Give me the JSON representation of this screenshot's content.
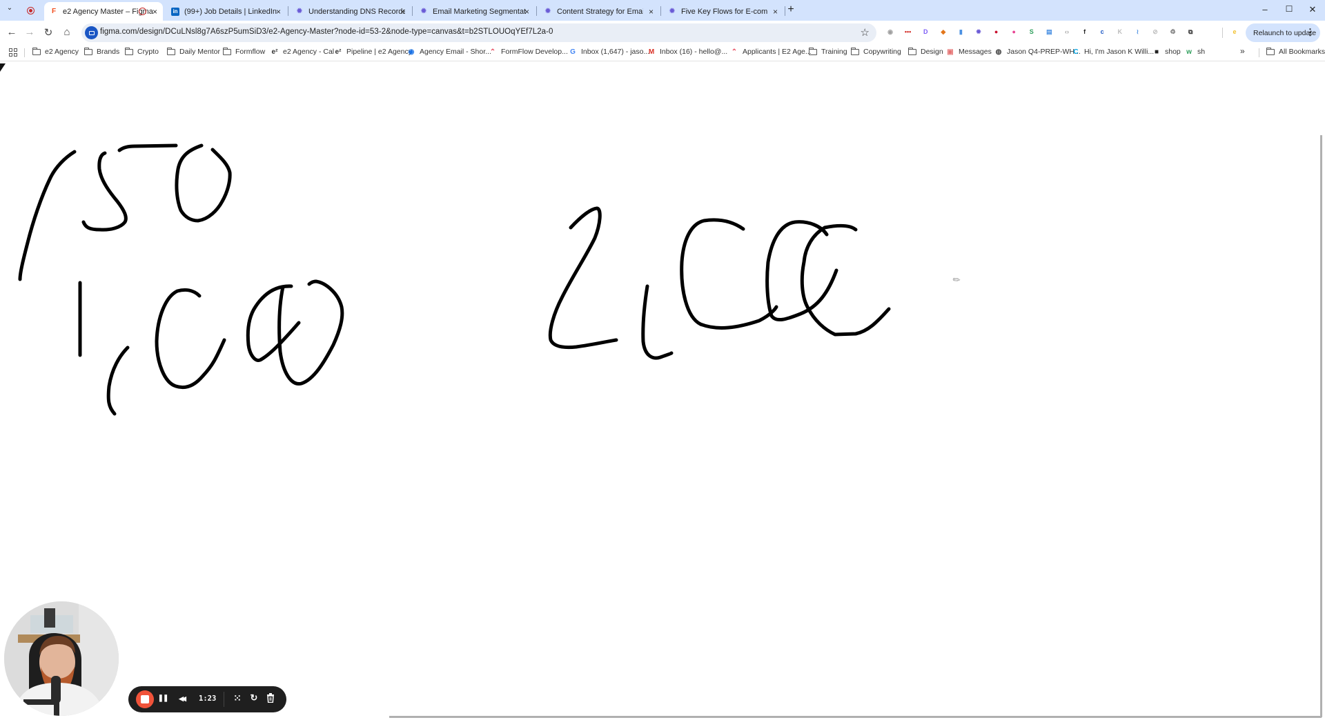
{
  "browser": {
    "tabs": [
      {
        "label": "e2 Agency Master – Figma",
        "favicon": "figma-icon",
        "active": true,
        "recording": true
      },
      {
        "label": "(99+) Job Details | LinkedIn",
        "favicon": "linkedin-icon",
        "active": false
      },
      {
        "label": "Understanding DNS Records 📊",
        "favicon": "gear-icon",
        "active": false
      },
      {
        "label": "Email Marketing Segmentation",
        "favicon": "gear-icon",
        "active": false
      },
      {
        "label": "Content Strategy for Email Mar",
        "favicon": "gear-icon",
        "active": false
      },
      {
        "label": "Five Key Flows for E-commerce",
        "favicon": "gear-icon",
        "active": false
      }
    ],
    "new_tab_label": "+",
    "close_label": "×",
    "window_controls": {
      "minimize": "–",
      "maximize": "☐",
      "close": "✕"
    },
    "nav": {
      "back": "←",
      "forward": "→",
      "reload": "↻",
      "home": "⌂"
    },
    "url": "figma.com/design/DCuLNsl8g7A6szP5umSiD3/e2-Agency-Master?node-id=53-2&node-type=canvas&t=b2STLOUOqYEf7L2a-0",
    "bookmark_star": "☆",
    "relaunch_label": "Relaunch to update",
    "menu_dots": "⋮",
    "extensions": [
      {
        "name": "camera-extension-icon",
        "glyph": "◉",
        "color": "#9e9e9e"
      },
      {
        "name": "lastpass-extension-icon",
        "glyph": "•••",
        "color": "#d32d27"
      },
      {
        "name": "d-extension-icon",
        "glyph": "D",
        "color": "#7c5cf5"
      },
      {
        "name": "metamask-extension-icon",
        "glyph": "◆",
        "color": "#e2761b"
      },
      {
        "name": "clipboard-extension-icon",
        "glyph": "▮",
        "color": "#4a90e2"
      },
      {
        "name": "gear-extension-icon",
        "glyph": "✹",
        "color": "#6b5bd6"
      },
      {
        "name": "recorder-extension-icon",
        "glyph": "●",
        "color": "#c8102e"
      },
      {
        "name": "color-picker-extension-icon",
        "glyph": "●",
        "color": "#e84393"
      },
      {
        "name": "whatsapp-extension-icon",
        "glyph": "S",
        "color": "#2e9e5b"
      },
      {
        "name": "window-extension-icon",
        "glyph": "▤",
        "color": "#4a90e2"
      },
      {
        "name": "code-extension-icon",
        "glyph": "‹›",
        "color": "#9e9e9e"
      },
      {
        "name": "font-extension-icon",
        "glyph": "f",
        "color": "#222222"
      },
      {
        "name": "blue-circle-extension-icon",
        "glyph": "c",
        "color": "#1a56c4"
      },
      {
        "name": "grey-k-extension-icon",
        "glyph": "K",
        "color": "#bdbdbd"
      },
      {
        "name": "wave-extension-icon",
        "glyph": "≀",
        "color": "#4a90e2"
      },
      {
        "name": "compass-extension-icon",
        "glyph": "⊘",
        "color": "#bdbdbd"
      },
      {
        "name": "recycle-extension-icon",
        "glyph": "♲",
        "color": "#555555"
      },
      {
        "name": "puzzle-extension-icon",
        "glyph": "⧉",
        "color": "#333333"
      },
      {
        "name": "profile-extension-icon",
        "glyph": "e",
        "color": "#f2c12e"
      }
    ],
    "bookmarks": [
      {
        "label": "e2 Agency",
        "icon": "folder"
      },
      {
        "label": "Brands",
        "icon": "folder"
      },
      {
        "label": "Crypto",
        "icon": "folder"
      },
      {
        "label": "Daily Mentor",
        "icon": "folder"
      },
      {
        "label": "Formflow",
        "icon": "folder"
      },
      {
        "label": "e2 Agency - Cal",
        "icon": "e2"
      },
      {
        "label": "Pipeline | e2 Agency",
        "icon": "e2"
      },
      {
        "label": "Agency Email - Shor...",
        "icon": "agency"
      },
      {
        "label": "FormFlow Develop...",
        "icon": "clickup"
      },
      {
        "label": "Inbox (1,647) - jaso...",
        "icon": "google"
      },
      {
        "label": "Inbox (16) - hello@...",
        "icon": "gmail"
      },
      {
        "label": "Applicants | E2 Age...",
        "icon": "clickup"
      },
      {
        "label": "Training",
        "icon": "folder"
      },
      {
        "label": "Copywriting",
        "icon": "folder"
      },
      {
        "label": "Design",
        "icon": "folder"
      },
      {
        "label": "Messages",
        "icon": "messages"
      },
      {
        "label": "Jason Q4-PREP-WH...",
        "icon": "globe"
      },
      {
        "label": "Hi, I'm Jason K Willi...",
        "icon": "canva"
      },
      {
        "label": "shop",
        "icon": "shop"
      },
      {
        "label": "sh",
        "icon": "webflow"
      }
    ],
    "bookmarks_overflow": "»",
    "all_bookmarks_label": "All Bookmarks"
  },
  "canvas": {
    "handwritten_text": [
      "1,500",
      "1,000",
      "2,000"
    ],
    "ink_color": "#000000"
  },
  "recorder": {
    "timer": "1:23",
    "stop_color": "#f0533a",
    "buttons": {
      "pause": "❚❚",
      "rewind": "◀◀",
      "grid": "⁙",
      "restart": "↻",
      "delete": "🗑"
    }
  }
}
